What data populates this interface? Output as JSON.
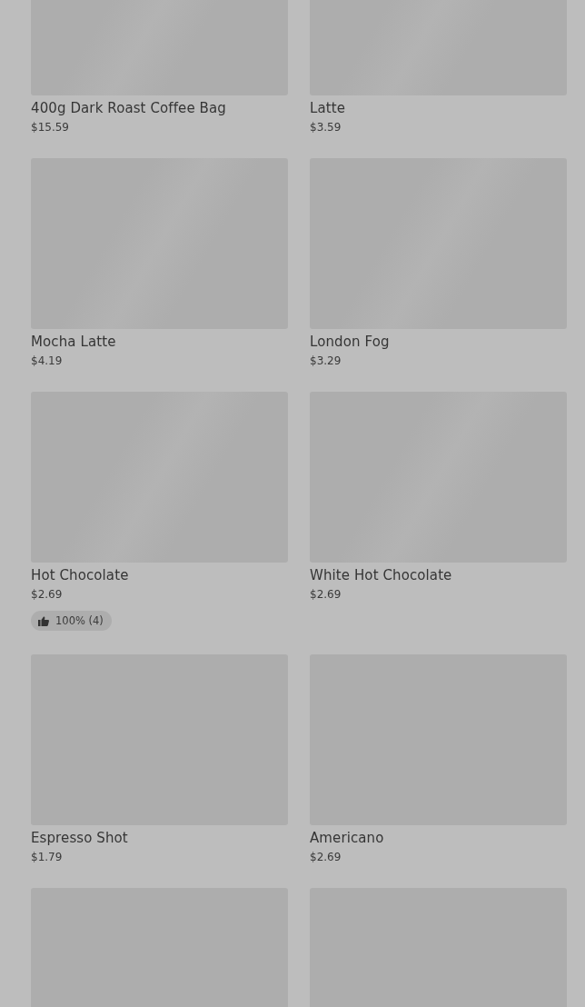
{
  "products": [
    {
      "kind": "item",
      "name": "400g Dark Roast Coffee Bag",
      "price": "$15.59"
    },
    {
      "kind": "item",
      "name": "Latte",
      "price": "$3.59"
    },
    {
      "kind": "item",
      "name": "Mocha Latte",
      "price": "$4.19"
    },
    {
      "kind": "item",
      "name": "London Fog",
      "price": "$3.29"
    },
    {
      "kind": "item",
      "name": "Hot Chocolate",
      "price": "$2.69",
      "rating": "100% (4)"
    },
    {
      "kind": "item",
      "name": "White Hot Chocolate",
      "price": "$2.69"
    },
    {
      "kind": "item",
      "name": "Espresso Shot",
      "price": "$1.79"
    },
    {
      "kind": "item",
      "name": "Americano",
      "price": "$2.69"
    },
    {
      "kind": "image_only"
    },
    {
      "kind": "image_only"
    }
  ]
}
